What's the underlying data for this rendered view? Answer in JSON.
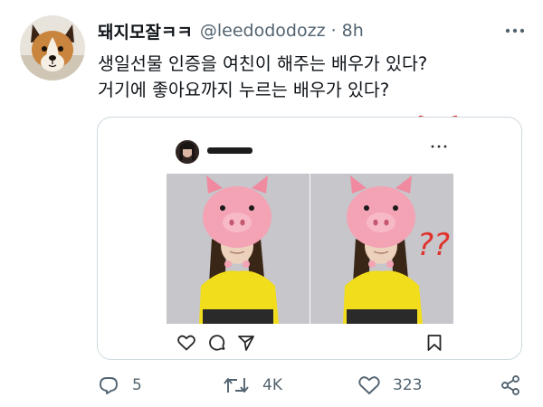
{
  "tweet": {
    "display_name": "돼지모잘ㅋㅋ",
    "handle": "@leedododozz",
    "separator": "·",
    "time": "8h",
    "lines": [
      "생일선물 인증을 여친이 해주는 배우가 있다?",
      "거기에 좋아요까지 누르는 배우가 있다?"
    ]
  },
  "embedded_post": {
    "annotation_text": "??",
    "icons": [
      "heart-outline-icon",
      "comment-icon",
      "send-icon",
      "bookmark-icon"
    ]
  },
  "actions": {
    "reply_count": "5",
    "retweet_count": "4K",
    "like_count": "323"
  },
  "colors": {
    "text_primary": "#0f1419",
    "text_secondary": "#536471",
    "card_border": "#cfd9de",
    "annotation_red": "#e0322b",
    "hat_pink": "#f4a3b4",
    "shirt_yellow": "#f2dd1c"
  }
}
